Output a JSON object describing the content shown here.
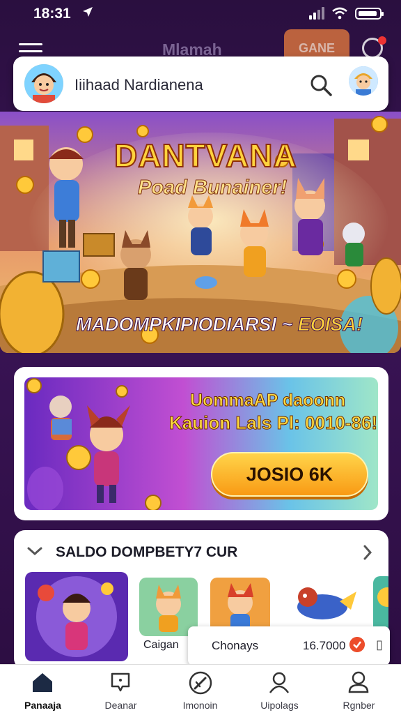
{
  "status_bar": {
    "time": "18:31"
  },
  "top_nav": {
    "title": "Mlamah",
    "game_label": "GANE"
  },
  "search": {
    "value": "Iiihaad Nardianena"
  },
  "hero": {
    "title": "DANTVANA",
    "subtitle": "Poad Bunainer!",
    "caption_main": "MADOMPKIPIODIARSI ~",
    "caption_accent": "EOISA!"
  },
  "promo": {
    "line1": "UommaAP daoonn",
    "line2": "Kauion Lals Pl: 0010-86!!",
    "button_label": "JOSIO 6K"
  },
  "section": {
    "title": "SALDO DOMPBETY7 CUR",
    "tiles": [
      {
        "label": "Caigan"
      }
    ]
  },
  "popup": {
    "name": "Chonays",
    "value": "16.7000"
  },
  "tabs": [
    {
      "label": "Panaaja",
      "active": true
    },
    {
      "label": "Deanar"
    },
    {
      "label": "Imonoin"
    },
    {
      "label": "Uipolags"
    },
    {
      "label": "Rgnber"
    }
  ],
  "colors": {
    "accent": "#f99a14",
    "brand": "#3a1456",
    "coin": "#ffd33d"
  },
  "icons": [
    "navigation-arrow-icon",
    "signal-icon",
    "wifi-icon",
    "battery-icon",
    "hamburger-menu-icon",
    "search-icon",
    "chevron-down-icon",
    "chevron-right-icon",
    "home-icon",
    "speech-bubble-icon",
    "compass-icon",
    "user-icon",
    "profile-icon"
  ]
}
